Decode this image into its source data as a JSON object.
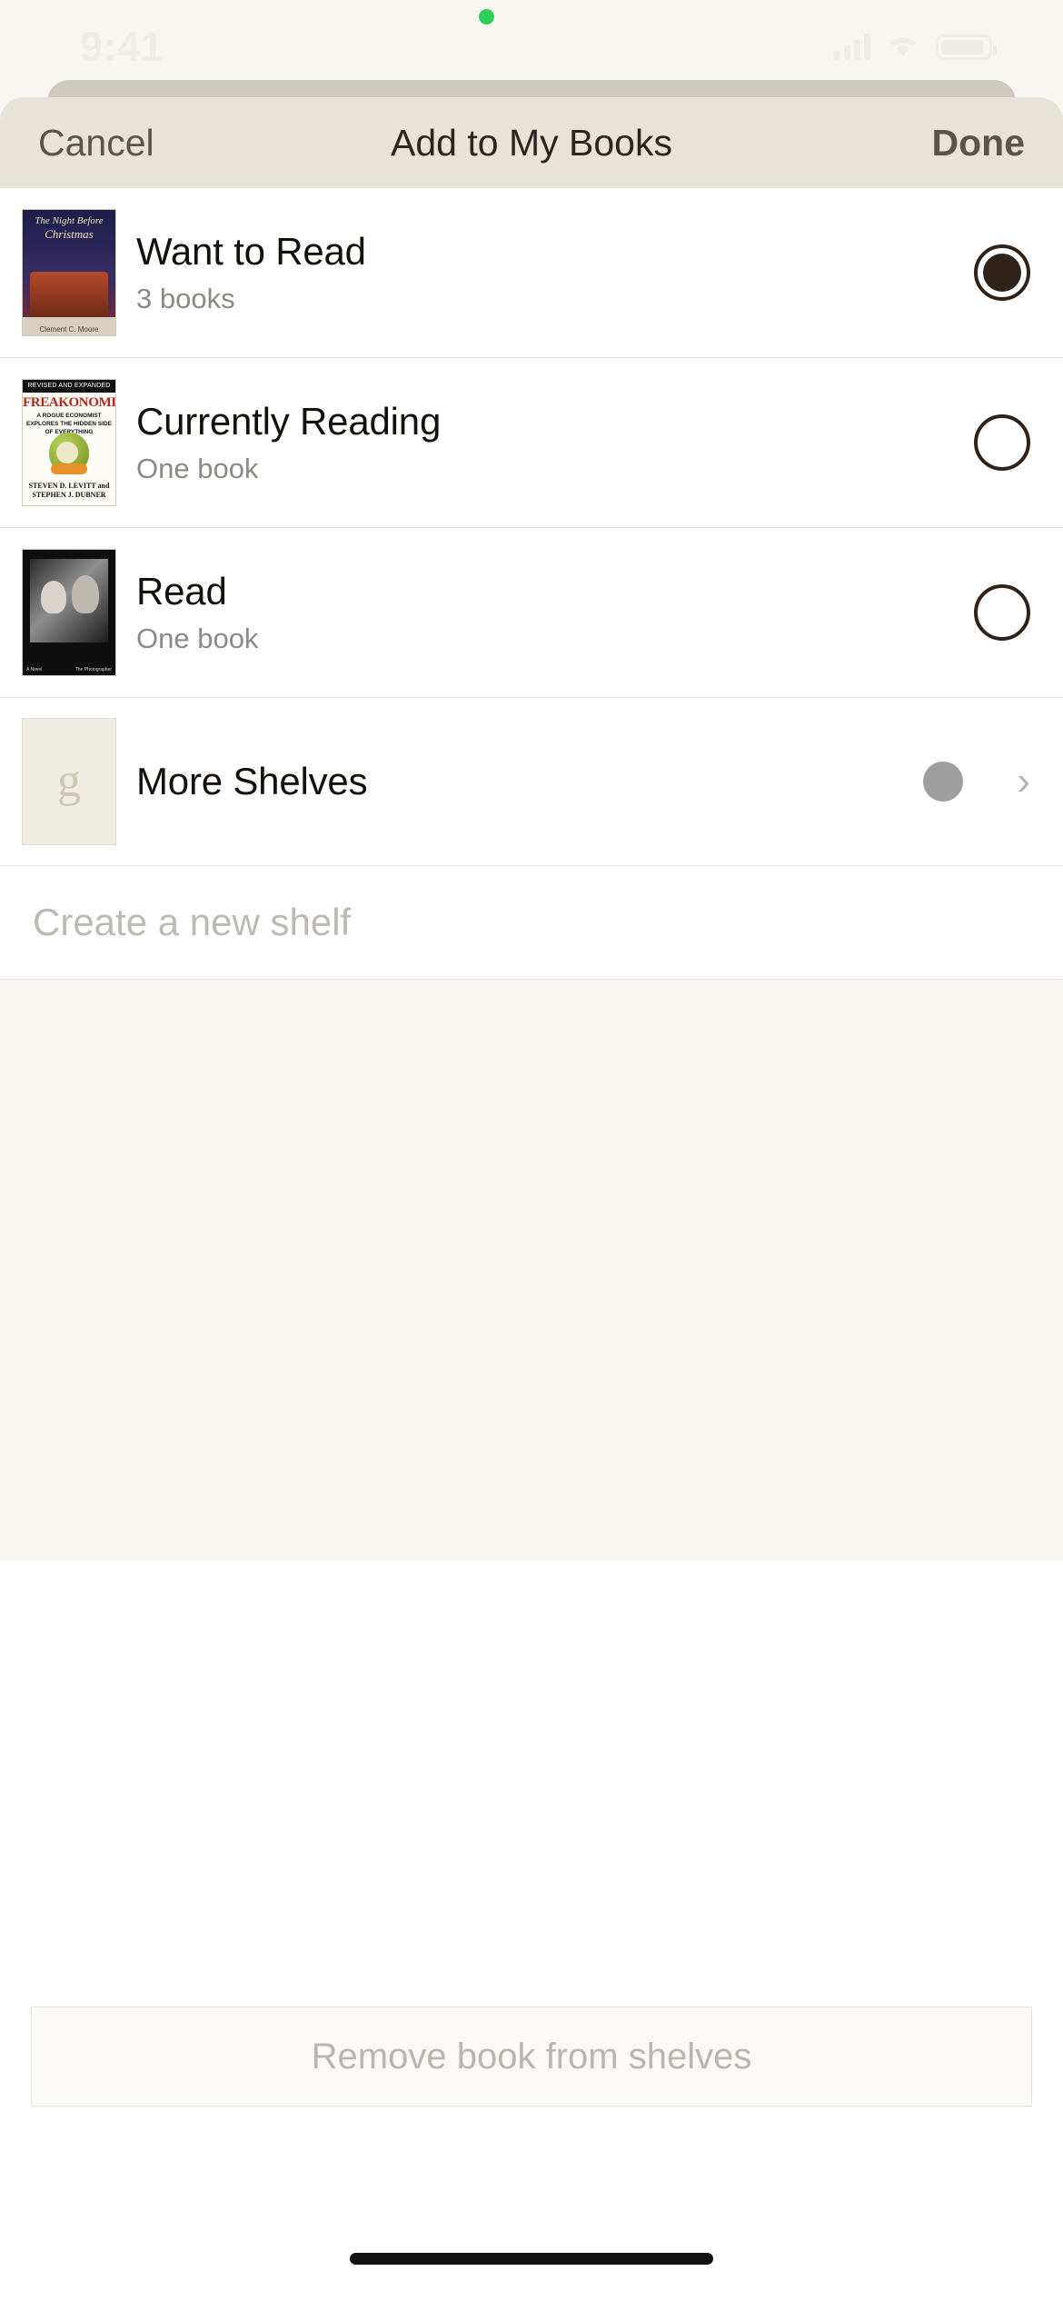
{
  "status_bar": {
    "time": "9:41",
    "icons": [
      "cellular-bars-icon",
      "wifi-icon",
      "battery-icon",
      "recording-indicator-dot"
    ]
  },
  "nav": {
    "cancel_label": "Cancel",
    "title": "Add to My Books",
    "done_label": "Done"
  },
  "shelves": [
    {
      "title": "Want to Read",
      "subtitle": "3 books",
      "selected": true,
      "cover": {
        "kind": "night-before-christmas",
        "line1": "The Night Before",
        "line2": "Christmas",
        "footer": "Clement C. Moore"
      }
    },
    {
      "title": "Currently Reading",
      "subtitle": "One book",
      "selected": false,
      "cover": {
        "kind": "freakonomics",
        "band": "REVISED AND EXPANDED EDITION",
        "title": "FREAKONOMICS",
        "sub": "A ROGUE ECONOMIST EXPLORES THE HIDDEN SIDE OF EVERYTHING",
        "authors": "STEVEN D. LEVITT and STEPHEN J. DUBNER"
      }
    },
    {
      "title": "Read",
      "subtitle": "One book",
      "selected": false,
      "cover": {
        "kind": "bw-photo",
        "caption_left": "A Novel",
        "caption_right": "The Photographer"
      }
    }
  ],
  "more_shelves": {
    "title": "More Shelves",
    "glyph": "g",
    "chevron": "chevron-right-icon"
  },
  "create_shelf": {
    "placeholder": "Create a new shelf"
  },
  "remove_button": {
    "label": "Remove book from shelves"
  },
  "colors": {
    "nav_background": "#e8e3d8",
    "page_background": "#f8f6f1",
    "accent": "#2f2319",
    "muted_text": "#8d8a85"
  }
}
